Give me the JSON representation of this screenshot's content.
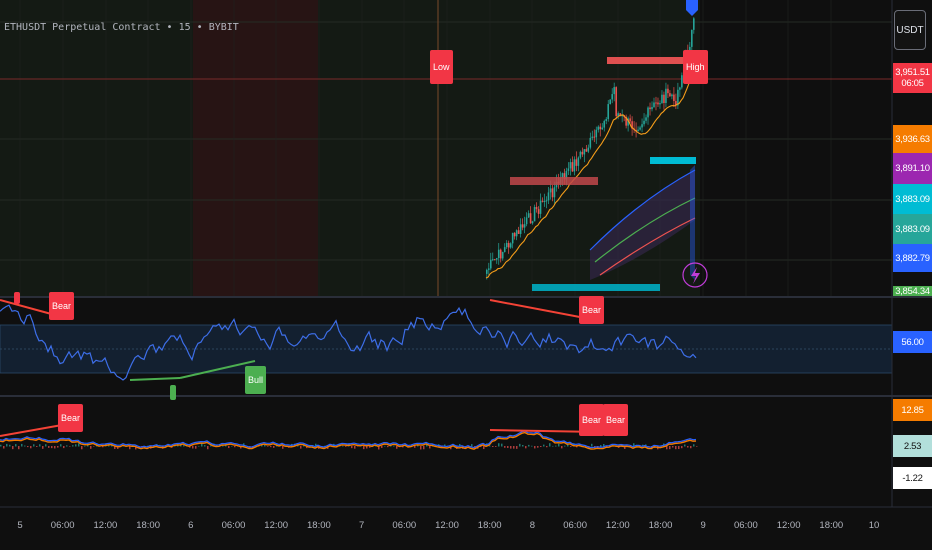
{
  "header": {
    "symbol_title": "ETHUSDT Perpetual Contract • 15 • BYBIT",
    "currency_label": "USDT"
  },
  "price_scale": {
    "tags": [
      {
        "id": "last",
        "text": "3,951.51",
        "sub": "06:05",
        "color": "#f23645"
      },
      {
        "id": "ma1",
        "text": "3,936.63",
        "color": "#f57c00"
      },
      {
        "id": "ma2",
        "text": "3,891.10",
        "color": "#9c27b0"
      },
      {
        "id": "band1",
        "text": "3,883.09",
        "color": "#00bcd4"
      },
      {
        "id": "band2",
        "text": "3,883.09",
        "color": "#26a69a"
      },
      {
        "id": "ma3",
        "text": "3,882.79",
        "color": "#2962ff"
      },
      {
        "id": "ma4",
        "text": "3,854.34",
        "color": "#4caf50"
      }
    ]
  },
  "rsi_pane": {
    "value": "56.00",
    "color": "#2962ff"
  },
  "macd_pane": {
    "tags": [
      {
        "text": "12.85",
        "color": "#f57c00"
      },
      {
        "text": "2.53",
        "color": "#b2dfdb"
      },
      {
        "text": "-1.22",
        "color": "#ffffff"
      }
    ]
  },
  "markers": {
    "low": "Low",
    "high": "High",
    "bear": "Bear",
    "bull": "Bull"
  },
  "time_axis": [
    "5",
    "06:00",
    "12:00",
    "18:00",
    "6",
    "06:00",
    "12:00",
    "18:00",
    "7",
    "06:00",
    "12:00",
    "18:00",
    "8",
    "06:00",
    "12:00",
    "18:00",
    "9",
    "06:00",
    "12:00",
    "18:00",
    "10"
  ],
  "colors": {
    "up": "#26a69a",
    "down": "#ef5350",
    "ma_orange": "#f59d1a",
    "rsi_line": "#3d6ee8",
    "macd_red": "#f44336"
  }
}
